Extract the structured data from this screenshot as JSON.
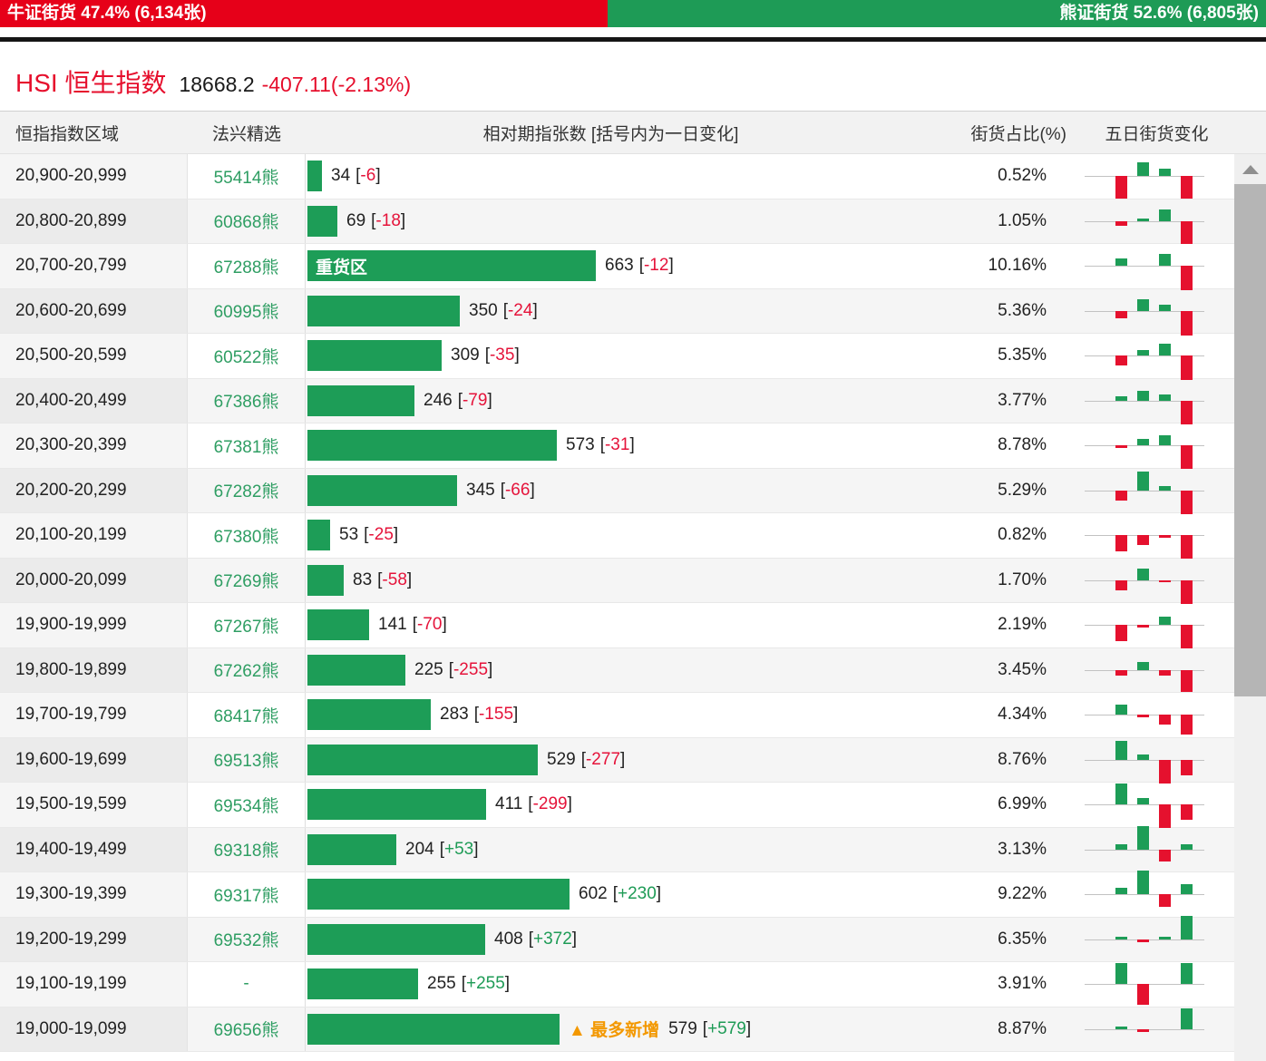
{
  "banner": {
    "bull_label": "牛证街货 47.4% (6,134张)",
    "bear_label": "熊证街货 52.6% (6,805张)",
    "bull_pct": 47.4,
    "bull_color": "#e60019",
    "bear_color": "#1e9b56"
  },
  "title": {
    "symbol": "HSI 恒生指数",
    "price": "18668.2",
    "change": "-407.11(-2.13%)"
  },
  "table": {
    "headers": {
      "range": "恒指指数区域",
      "pick": "法兴精选",
      "bars": "相对期指张数 [括号内为一日变化]",
      "pct": "街货占比(%)",
      "five_day": "五日街货变化"
    },
    "max_bar_value": 663,
    "rows": [
      {
        "range": "20,900-20,999",
        "code": "55414熊",
        "value": 34,
        "change": "-6",
        "pct": "0.52%",
        "spark": [
          0,
          -25,
          15,
          8,
          -25
        ]
      },
      {
        "range": "20,800-20,899",
        "code": "60868熊",
        "value": 69,
        "change": "-18",
        "pct": "1.05%",
        "spark": [
          0,
          -5,
          3,
          13,
          -25
        ]
      },
      {
        "range": "20,700-20,799",
        "code": "67288熊",
        "value": 663,
        "change": "-12",
        "pct": "10.16%",
        "bar_label": "重货区",
        "spark": [
          0,
          8,
          0,
          13,
          -27
        ]
      },
      {
        "range": "20,600-20,699",
        "code": "60995熊",
        "value": 350,
        "change": "-24",
        "pct": "5.36%",
        "spark": [
          0,
          -8,
          13,
          7,
          -27
        ]
      },
      {
        "range": "20,500-20,599",
        "code": "60522熊",
        "value": 309,
        "change": "-35",
        "pct": "5.35%",
        "spark": [
          0,
          -11,
          6,
          13,
          -27
        ]
      },
      {
        "range": "20,400-20,499",
        "code": "67386熊",
        "value": 246,
        "change": "-79",
        "pct": "3.77%",
        "spark": [
          0,
          5,
          11,
          7,
          -26
        ]
      },
      {
        "range": "20,300-20,399",
        "code": "67381熊",
        "value": 573,
        "change": "-31",
        "pct": "8.78%",
        "spark": [
          0,
          -3,
          7,
          11,
          -26
        ]
      },
      {
        "range": "20,200-20,299",
        "code": "67282熊",
        "value": 345,
        "change": "-66",
        "pct": "5.29%",
        "spark": [
          0,
          -11,
          21,
          5,
          -26
        ]
      },
      {
        "range": "20,100-20,199",
        "code": "67380熊",
        "value": 53,
        "change": "-25",
        "pct": "0.82%",
        "spark": [
          0,
          -18,
          -11,
          -3,
          -26
        ]
      },
      {
        "range": "20,000-20,099",
        "code": "67269熊",
        "value": 83,
        "change": "-58",
        "pct": "1.70%",
        "spark": [
          0,
          -11,
          13,
          -2,
          -26
        ]
      },
      {
        "range": "19,900-19,999",
        "code": "67267熊",
        "value": 141,
        "change": "-70",
        "pct": "2.19%",
        "spark": [
          0,
          -18,
          -3,
          9,
          -26
        ]
      },
      {
        "range": "19,800-19,899",
        "code": "67262熊",
        "value": 225,
        "change": "-255",
        "pct": "3.45%",
        "spark": [
          0,
          -6,
          9,
          -6,
          -24
        ]
      },
      {
        "range": "19,700-19,799",
        "code": "68417熊",
        "value": 283,
        "change": "-155",
        "pct": "4.34%",
        "spark": [
          0,
          11,
          -3,
          -11,
          -22
        ]
      },
      {
        "range": "19,600-19,699",
        "code": "69513熊",
        "value": 529,
        "change": "-277",
        "pct": "8.76%",
        "spark": [
          0,
          21,
          6,
          -26,
          -17
        ]
      },
      {
        "range": "19,500-19,599",
        "code": "69534熊",
        "value": 411,
        "change": "-299",
        "pct": "6.99%",
        "spark": [
          0,
          23,
          7,
          -26,
          -17
        ]
      },
      {
        "range": "19,400-19,499",
        "code": "69318熊",
        "value": 204,
        "change": "+53",
        "pct": "3.13%",
        "spark": [
          0,
          6,
          26,
          -13,
          6
        ]
      },
      {
        "range": "19,300-19,399",
        "code": "69317熊",
        "value": 602,
        "change": "+230",
        "pct": "9.22%",
        "spark": [
          0,
          7,
          26,
          -14,
          11
        ]
      },
      {
        "range": "19,200-19,299",
        "code": "69532熊",
        "value": 408,
        "change": "+372",
        "pct": "6.35%",
        "spark": [
          0,
          3,
          -3,
          3,
          26
        ]
      },
      {
        "range": "19,100-19,199",
        "code": "-",
        "value": 255,
        "change": "+255",
        "pct": "3.91%",
        "spark": [
          0,
          23,
          -23,
          0,
          23
        ]
      },
      {
        "range": "19,000-19,099",
        "code": "69656熊",
        "value": 579,
        "change": "+579",
        "pct": "8.87%",
        "most_added_label": "▲ 最多新增",
        "spark": [
          0,
          3,
          -3,
          0,
          23
        ]
      }
    ]
  }
}
